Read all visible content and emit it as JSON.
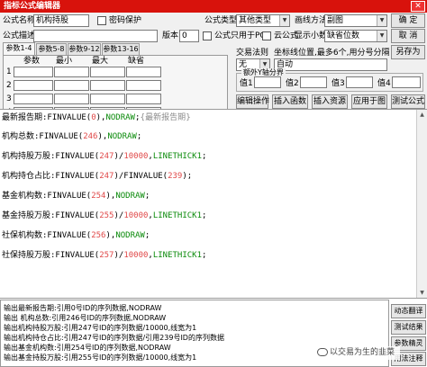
{
  "window": {
    "title": "指标公式编辑器",
    "close_glyph": "✕"
  },
  "form": {
    "name_label": "公式名称",
    "name_value": "机构持股",
    "password_label": "密码保护",
    "formula_type_label": "公式类型",
    "formula_type_value": "其他类型",
    "draw_method_label": "画线方法",
    "draw_method_value": "副图",
    "confirm_button": "确 定",
    "cancel_button": "取 消",
    "desc_label": "公式描述",
    "version_label": "版本",
    "version_value": "0",
    "pc_only_label": "公式只用于PC",
    "cloud_label": "云公式",
    "decimals_label": "显示小数",
    "decimals_value": "缺省位数",
    "save_as_button": "另存为",
    "trade_rule_label": "交易法则",
    "trade_rule_value": "无",
    "coord_label": "坐标线位置,最多6个,用分号分隔",
    "coord_value": "自动",
    "y_group_label": "额外Y轴分界",
    "y_values": [
      {
        "label": "值1",
        "value": ""
      },
      {
        "label": "值2",
        "value": ""
      },
      {
        "label": "值3",
        "value": ""
      },
      {
        "label": "值4",
        "value": ""
      }
    ]
  },
  "tabs": [
    "参数1-4",
    "参数5-8",
    "参数9-12",
    "参数13-16"
  ],
  "param_table": {
    "headers": [
      "参数",
      "最小",
      "最大",
      "缺省"
    ],
    "row_labels": [
      "1",
      "2",
      "3",
      "4"
    ]
  },
  "toolbar": [
    "编辑操作",
    "插入函数",
    "插入资源",
    "应用于图",
    "测试公式"
  ],
  "code": [
    {
      "name": "最新报告期",
      "rest": ":FINVALUE(0),NODRAW;",
      "comment": "{最新报告期}"
    },
    {
      "name": "机构总数",
      "rest": ":FINVALUE(246),NODRAW;"
    },
    {
      "name": "机构持股万股",
      "rest": ":FINVALUE(247)/10000,LINETHICK1;"
    },
    {
      "name": "机构持仓占比",
      "rest": ":FINVALUE(247)/FINVALUE(239);"
    },
    {
      "name": "基金机构数",
      "rest": ":FINVALUE(254),NODRAW;"
    },
    {
      "name": "基金持股万股",
      "rest": ":FINVALUE(255)/10000,LINETHICK1;"
    },
    {
      "name": "社保机构数",
      "rest": ":FINVALUE(256),NODRAW;"
    },
    {
      "name": "社保持股万股",
      "rest": ":FINVALUE(257)/10000,LINETHICK1;"
    }
  ],
  "output": [
    "输出最新报告期:引用0号ID的序列数据,NODRAW",
    "输出 机构总数:引用246号ID的序列数据,NODRAW",
    "输出机构持股万股:引用247号ID的序列数据/10000,线宽为1",
    "输出机构持仓占比:引用247号ID的序列数据/引用239号ID的序列数据",
    "输出基金机构数:引用254号ID的序列数据,NODRAW",
    "输出基金持股万股:引用255号ID的序列数据/10000,线宽为1"
  ],
  "side_buttons": [
    "动态翻译",
    "测试结果",
    "参数精灵",
    "用法注释"
  ],
  "watermark": "以交易为生的韭菜"
}
